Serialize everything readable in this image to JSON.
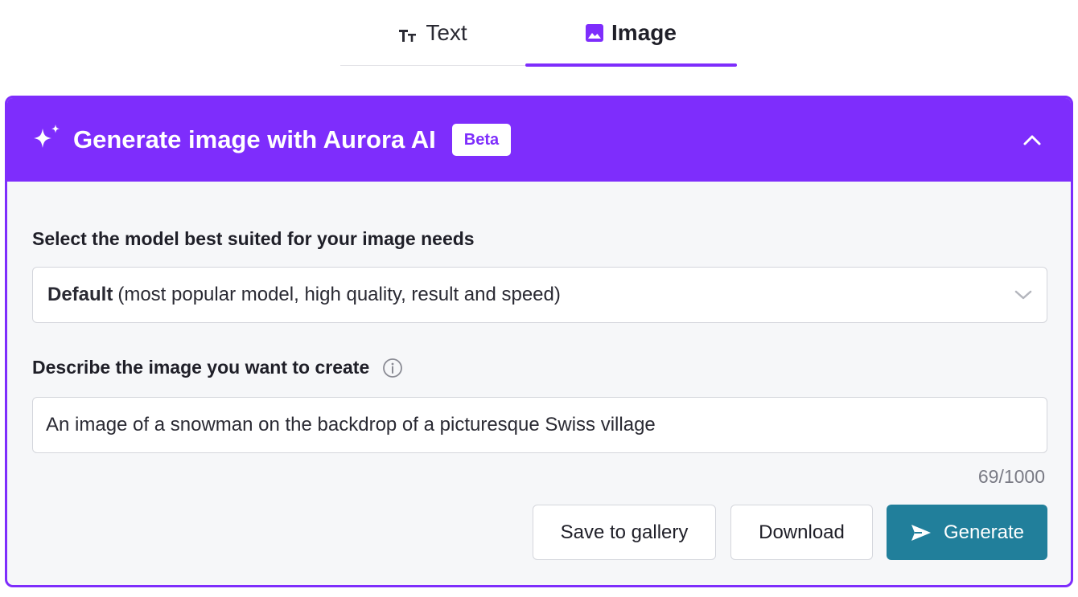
{
  "tabs": {
    "text_label": "Text",
    "image_label": "Image",
    "text_icon": "text-format-icon",
    "image_icon": "image-icon",
    "active": "Image"
  },
  "header": {
    "title": "Generate image with Aurora AI",
    "badge": "Beta",
    "icon": "sparkles-icon",
    "collapse_icon": "chevron-up-icon"
  },
  "model": {
    "label": "Select the model best suited for your image needs",
    "selected_name": "Default",
    "selected_desc": "(most popular model, high quality, result and speed)"
  },
  "description": {
    "label": "Describe the image you want to create",
    "value": "An image of a snowman on the backdrop of a picturesque Swiss village",
    "counter": "69/1000"
  },
  "actions": {
    "save_label": "Save to gallery",
    "download_label": "Download",
    "generate_label": "Generate"
  },
  "colors": {
    "accent": "#7e2dfc",
    "generate": "#217f9b"
  }
}
